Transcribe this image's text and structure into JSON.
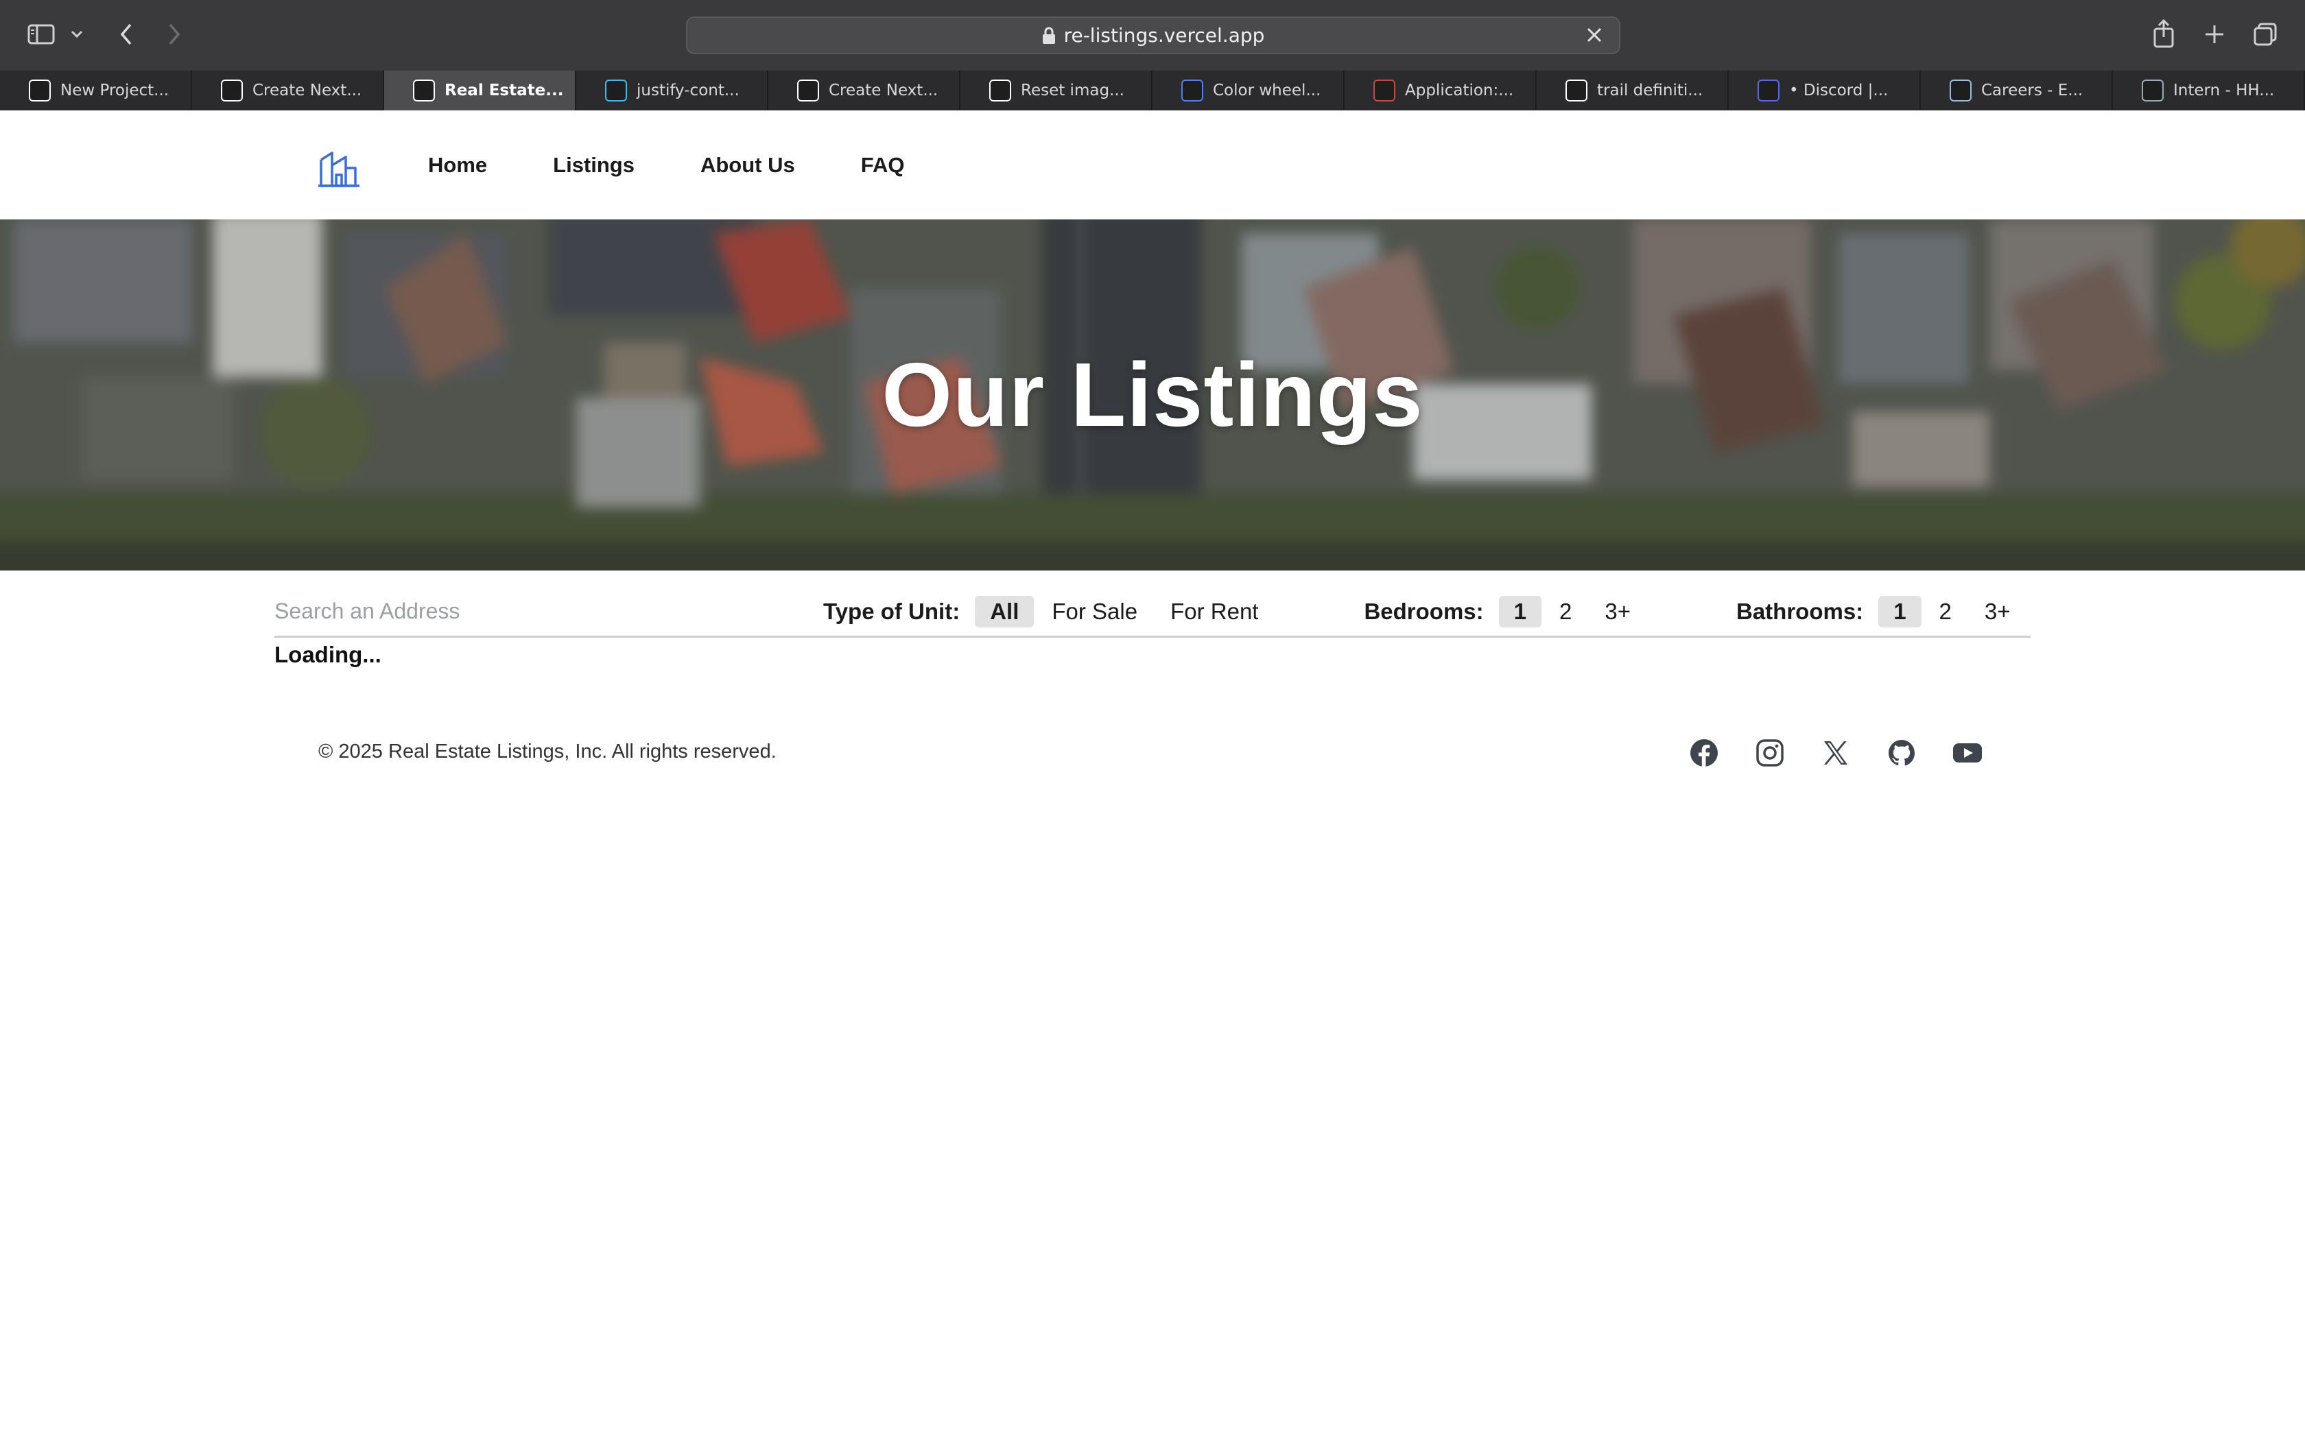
{
  "browser": {
    "url": "re-listings.vercel.app",
    "tabs": [
      {
        "label": "New Project...",
        "icon": "vercel-icon",
        "color": "#ffffff"
      },
      {
        "label": "Create Next...",
        "icon": "vercel-icon",
        "color": "#ffffff"
      },
      {
        "label": "Real Estate...",
        "icon": "vercel-icon",
        "color": "#ffffff"
      },
      {
        "label": "justify-cont...",
        "icon": "tailwind-icon",
        "color": "#38bdf8"
      },
      {
        "label": "Create Next...",
        "icon": "vercel-icon",
        "color": "#ffffff"
      },
      {
        "label": "Reset imag...",
        "icon": "openai-icon",
        "color": "#ffffff"
      },
      {
        "label": "Color wheel...",
        "icon": "canva-icon",
        "color": "#4f7cff"
      },
      {
        "label": "Application:...",
        "icon": "app-icon",
        "color": "#c44"
      },
      {
        "label": "trail definiti...",
        "icon": "google-icon",
        "color": "#ffffff"
      },
      {
        "label": "• Discord |...",
        "icon": "discord-icon",
        "color": "#5865f2"
      },
      {
        "label": "Careers - E...",
        "icon": "chart-icon",
        "color": "#9bd"
      },
      {
        "label": "Intern - HH...",
        "icon": "ship-icon",
        "color": "#9ab"
      }
    ]
  },
  "nav": {
    "home": "Home",
    "listings": "Listings",
    "about": "About Us",
    "faq": "FAQ"
  },
  "hero": {
    "title": "Our Listings"
  },
  "filters": {
    "search_placeholder": "Search an Address",
    "type_label": "Type of Unit:",
    "type_options": [
      "All",
      "For Sale",
      "For Rent"
    ],
    "type_selected": "All",
    "bedrooms_label": "Bedrooms:",
    "bedroom_options": [
      "1",
      "2",
      "3+"
    ],
    "bedroom_selected": "1",
    "bathrooms_label": "Bathrooms:",
    "bathroom_options": [
      "1",
      "2",
      "3+"
    ],
    "bathroom_selected": "1"
  },
  "status": {
    "loading": "Loading..."
  },
  "footer": {
    "copyright": "© 2025 Real Estate Listings, Inc. All rights reserved.",
    "socials": [
      "facebook-icon",
      "instagram-icon",
      "x-icon",
      "github-icon",
      "youtube-icon"
    ]
  },
  "colors": {
    "accent": "#3b6fd8",
    "selected_bg": "#e2e2e2"
  }
}
